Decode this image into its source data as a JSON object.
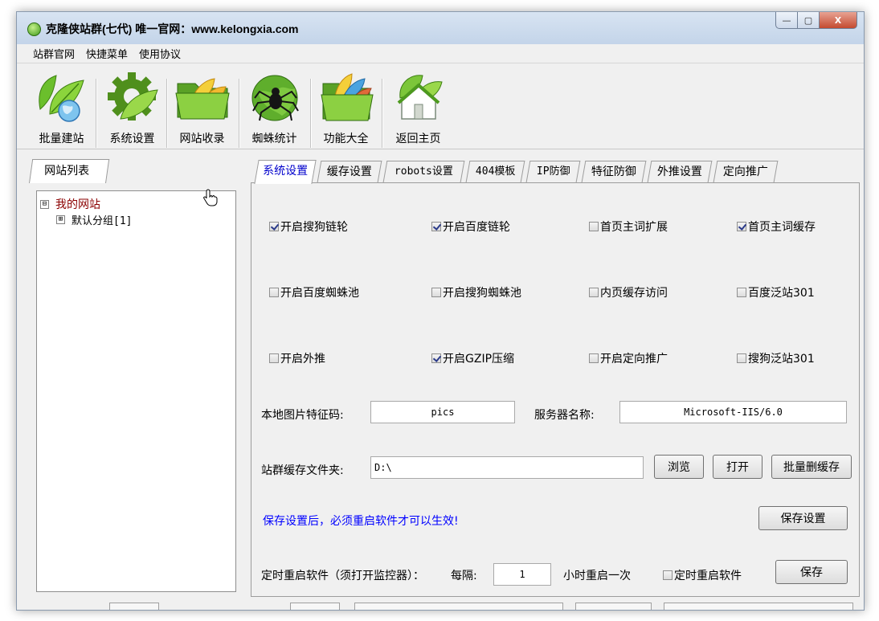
{
  "window": {
    "title": "克隆侠站群(七代) 唯一官网：www.kelongxia.com",
    "controls": {
      "minimize": "—",
      "maximize": "▢",
      "close": "X"
    }
  },
  "menu": [
    "站群官网",
    "快捷菜单",
    "使用协议"
  ],
  "toolbar": [
    {
      "label": "批量建站",
      "icon": "leaves-globe-icon"
    },
    {
      "label": "系统设置",
      "icon": "gear-leaf-icon"
    },
    {
      "label": "网站收录",
      "icon": "folder-leaves-icon"
    },
    {
      "label": "蜘蛛统计",
      "icon": "spider-globe-icon"
    },
    {
      "label": "功能大全",
      "icon": "folder-colorful-icon"
    },
    {
      "label": "返回主页",
      "icon": "home-icon"
    }
  ],
  "left_panel": {
    "tab": "网站列表",
    "tree": {
      "root": {
        "expander": "⊟",
        "label": "我的网站"
      },
      "child": {
        "expander": "⊞",
        "label": "默认分组[1]"
      }
    }
  },
  "tabs": [
    "系统设置",
    "缓存设置",
    "robots设置",
    "404模板",
    "IP防御",
    "特征防御",
    "外推设置",
    "定向推广"
  ],
  "active_tab": 0,
  "checkboxes": [
    [
      {
        "label": "开启搜狗链轮",
        "checked": true
      },
      {
        "label": "开启百度链轮",
        "checked": true
      },
      {
        "label": "首页主词扩展",
        "checked": false
      },
      {
        "label": "首页主词缓存",
        "checked": true
      }
    ],
    [
      {
        "label": "开启百度蜘蛛池",
        "checked": false
      },
      {
        "label": "开启搜狗蜘蛛池",
        "checked": false
      },
      {
        "label": "内页缓存访问",
        "checked": false
      },
      {
        "label": "百度泛站301",
        "checked": false
      }
    ],
    [
      {
        "label": "开启外推",
        "checked": false
      },
      {
        "label": "开启GZIP压缩",
        "checked": true
      },
      {
        "label": "开启定向推广",
        "checked": false
      },
      {
        "label": "搜狗泛站301",
        "checked": false
      }
    ]
  ],
  "fields": {
    "image_code_label": "本地图片特征码:",
    "image_code_value": "pics",
    "server_name_label": "服务器名称:",
    "server_name_value": "Microsoft-IIS/6.0",
    "cache_folder_label": "站群缓存文件夹:",
    "cache_folder_value": "D:\\"
  },
  "buttons": {
    "browse": "浏览",
    "open": "打开",
    "batch_delete": "批量删缓存",
    "save_settings": "保存设置",
    "save": "保存"
  },
  "notice": "保存设置后，必须重启软件才可以生效!",
  "restart": {
    "label": "定时重启软件（须打开监控器）：",
    "every_label": "每隔:",
    "interval": "1",
    "unit": "小时重启一次",
    "checkbox_label": "定时重启软件",
    "checked": false
  }
}
